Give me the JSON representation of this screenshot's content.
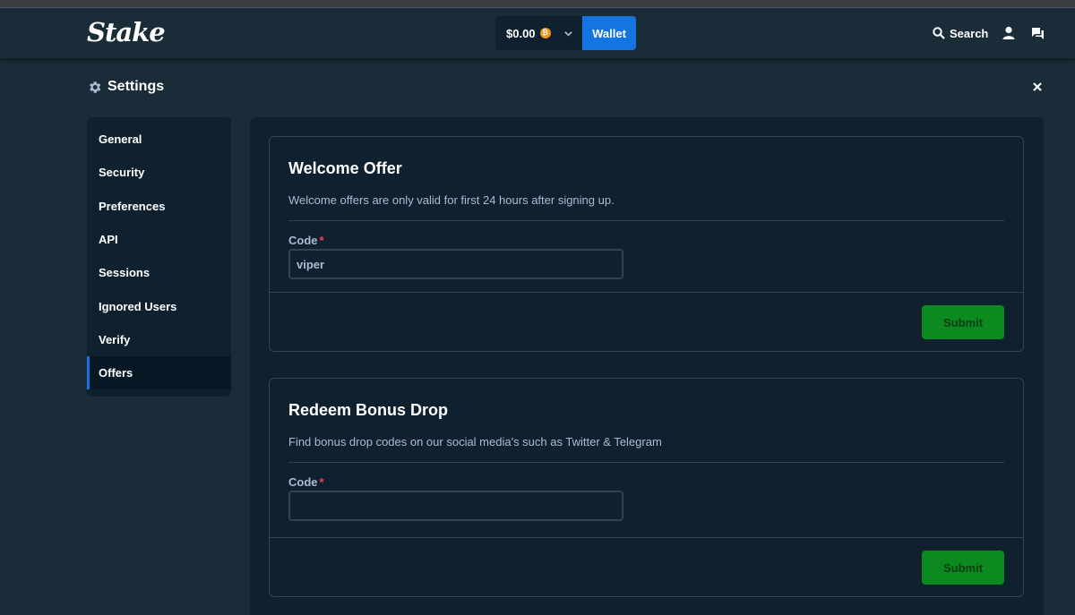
{
  "header": {
    "logo": "Stake",
    "balance": "$0.00",
    "currency_symbol": "₿",
    "wallet_label": "Wallet",
    "search_label": "Search"
  },
  "settings": {
    "title": "Settings"
  },
  "sidebar": {
    "items": [
      {
        "label": "General"
      },
      {
        "label": "Security"
      },
      {
        "label": "Preferences"
      },
      {
        "label": "API"
      },
      {
        "label": "Sessions"
      },
      {
        "label": "Ignored Users"
      },
      {
        "label": "Verify"
      },
      {
        "label": "Offers",
        "active": true
      }
    ]
  },
  "welcome_offer": {
    "title": "Welcome Offer",
    "description": "Welcome offers are only valid for first 24 hours after signing up.",
    "code_label": "Code",
    "required_mark": "*",
    "code_value": "viper",
    "submit_label": "Submit"
  },
  "bonus_drop": {
    "title": "Redeem Bonus Drop",
    "description": "Find bonus drop codes on our social media's such as Twitter & Telegram",
    "code_label": "Code",
    "required_mark": "*",
    "code_value": "",
    "submit_label": "Submit"
  },
  "colors": {
    "background": "#1a2c38",
    "panel": "#0f212e",
    "accent_blue": "#1475e1",
    "submit_green": "#0d8a1f",
    "required_red": "#ed4163"
  }
}
